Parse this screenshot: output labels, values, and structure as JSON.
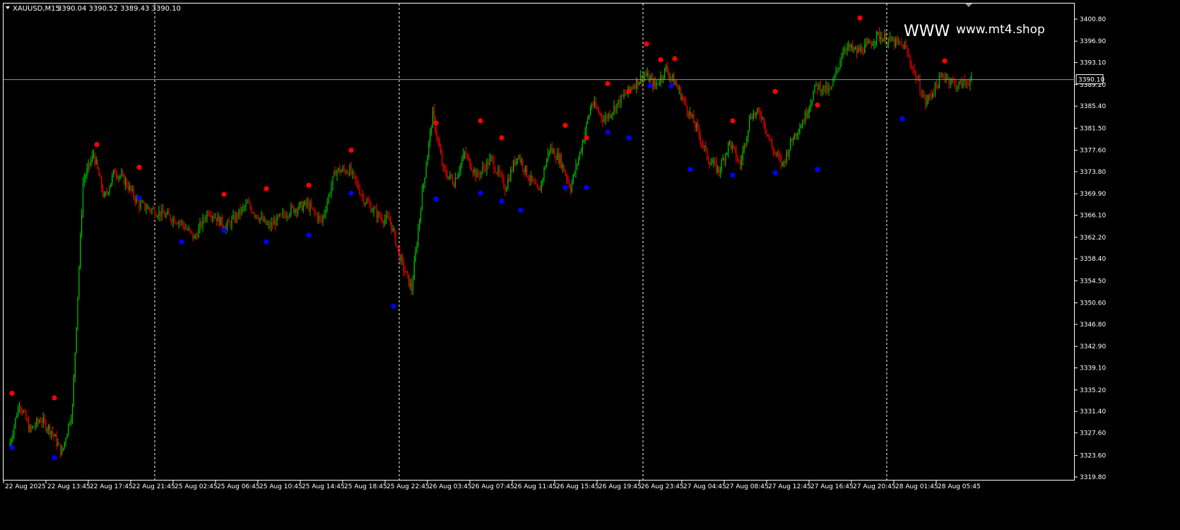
{
  "header": {
    "symbol_label": "XAUUSD,M15",
    "ohlc_label": "3390.04 3390.52 3389.43 3390.10"
  },
  "watermark": {
    "left_text": "WWW",
    "right_text": "www.mt4.shop"
  },
  "colors": {
    "background": "#000000",
    "frame": "#ffffff",
    "bull": "#00c800",
    "bear": "#ff0000",
    "grid": "#ffffff",
    "price_line": "#8a96a6",
    "dot_high": "#ff0000",
    "dot_low": "#0000ff",
    "axis_text": "#ffffff"
  },
  "chart_data": {
    "type": "candlestick",
    "symbol": "XAUUSD",
    "timeframe": "M15",
    "ylim": [
      3319.8,
      3400.8
    ],
    "y_ticks": [
      "3400.80",
      "3396.90",
      "3393.10",
      "3389.20",
      "3385.40",
      "3381.50",
      "3377.60",
      "3373.80",
      "3369.90",
      "3366.10",
      "3362.20",
      "3358.40",
      "3354.50",
      "3350.60",
      "3346.80",
      "3342.90",
      "3339.10",
      "3335.20",
      "3331.40",
      "3327.60",
      "3323.60",
      "3319.80"
    ],
    "x_labels": [
      "22 Aug 2025",
      "22 Aug 13:45",
      "22 Aug 17:45",
      "22 Aug 21:45",
      "25 Aug 02:45",
      "25 Aug 06:45",
      "25 Aug 10:45",
      "25 Aug 14:45",
      "25 Aug 18:45",
      "25 Aug 22:45",
      "26 Aug 03:45",
      "26 Aug 07:45",
      "26 Aug 11:45",
      "26 Aug 15:45",
      "26 Aug 19:45",
      "26 Aug 23:45",
      "27 Aug 04:45",
      "27 Aug 08:45",
      "27 Aug 12:45",
      "27 Aug 16:45",
      "27 Aug 20:45",
      "28 Aug 01:45",
      "28 Aug 05:45"
    ],
    "session_separators": [
      "22 Aug 21:45",
      "25 Aug 22:45",
      "26 Aug 23:45",
      "27 Aug 20:45"
    ],
    "current_price": 3390.1,
    "current_price_label": "3390.10",
    "price_path": [
      {
        "x": "22 Aug 2025",
        "y": 3325
      },
      {
        "x": "22 Aug 2025",
        "y": 3333
      },
      {
        "x": "22 Aug 2025",
        "y": 3328
      },
      {
        "x": "22 Aug 2025",
        "y": 3330
      },
      {
        "x": "22 Aug 13:45",
        "y": 3328
      },
      {
        "x": "22 Aug 13:45",
        "y": 3324
      },
      {
        "x": "22 Aug 13:45",
        "y": 3332
      },
      {
        "x": "22 Aug 13:45",
        "y": 3372
      },
      {
        "x": "22 Aug 17:45",
        "y": 3377
      },
      {
        "x": "22 Aug 17:45",
        "y": 3369
      },
      {
        "x": "22 Aug 17:45",
        "y": 3374
      },
      {
        "x": "22 Aug 17:45",
        "y": 3372
      },
      {
        "x": "22 Aug 21:45",
        "y": 3368
      },
      {
        "x": "25 Aug 02:45",
        "y": 3365
      },
      {
        "x": "25 Aug 02:45",
        "y": 3362
      },
      {
        "x": "25 Aug 02:45",
        "y": 3367
      },
      {
        "x": "25 Aug 06:45",
        "y": 3364
      },
      {
        "x": "25 Aug 06:45",
        "y": 3368
      },
      {
        "x": "25 Aug 10:45",
        "y": 3364
      },
      {
        "x": "25 Aug 10:45",
        "y": 3367
      },
      {
        "x": "25 Aug 14:45",
        "y": 3368
      },
      {
        "x": "25 Aug 14:45",
        "y": 3365
      },
      {
        "x": "25 Aug 14:45",
        "y": 3374
      },
      {
        "x": "25 Aug 18:45",
        "y": 3374
      },
      {
        "x": "25 Aug 18:45",
        "y": 3369
      },
      {
        "x": "25 Aug 18:45",
        "y": 3366
      },
      {
        "x": "25 Aug 22:45",
        "y": 3365
      },
      {
        "x": "25 Aug 22:45",
        "y": 3358
      },
      {
        "x": "25 Aug 22:45",
        "y": 3353
      },
      {
        "x": "25 Aug 22:45",
        "y": 3370
      },
      {
        "x": "26 Aug 03:45",
        "y": 3384
      },
      {
        "x": "26 Aug 03:45",
        "y": 3374
      },
      {
        "x": "26 Aug 03:45",
        "y": 3372
      },
      {
        "x": "26 Aug 03:45",
        "y": 3377
      },
      {
        "x": "26 Aug 07:45",
        "y": 3373
      },
      {
        "x": "26 Aug 07:45",
        "y": 3376
      },
      {
        "x": "26 Aug 07:45",
        "y": 3371
      },
      {
        "x": "26 Aug 11:45",
        "y": 3377
      },
      {
        "x": "26 Aug 11:45",
        "y": 3373
      },
      {
        "x": "26 Aug 11:45",
        "y": 3370
      },
      {
        "x": "26 Aug 11:45",
        "y": 3378
      },
      {
        "x": "26 Aug 15:45",
        "y": 3376
      },
      {
        "x": "26 Aug 15:45",
        "y": 3371
      },
      {
        "x": "26 Aug 15:45",
        "y": 3378
      },
      {
        "x": "26 Aug 15:45",
        "y": 3386
      },
      {
        "x": "26 Aug 19:45",
        "y": 3383
      },
      {
        "x": "26 Aug 19:45",
        "y": 3386
      },
      {
        "x": "26 Aug 19:45",
        "y": 3389
      },
      {
        "x": "26 Aug 23:45",
        "y": 3391
      },
      {
        "x": "26 Aug 23:45",
        "y": 3389
      },
      {
        "x": "26 Aug 23:45",
        "y": 3392
      },
      {
        "x": "26 Aug 23:45",
        "y": 3389
      },
      {
        "x": "27 Aug 04:45",
        "y": 3385
      },
      {
        "x": "27 Aug 04:45",
        "y": 3381
      },
      {
        "x": "27 Aug 04:45",
        "y": 3376
      },
      {
        "x": "27 Aug 04:45",
        "y": 3374
      },
      {
        "x": "27 Aug 08:45",
        "y": 3379
      },
      {
        "x": "27 Aug 08:45",
        "y": 3375
      },
      {
        "x": "27 Aug 08:45",
        "y": 3384
      },
      {
        "x": "27 Aug 08:45",
        "y": 3384
      },
      {
        "x": "27 Aug 12:45",
        "y": 3378
      },
      {
        "x": "27 Aug 12:45",
        "y": 3375
      },
      {
        "x": "27 Aug 12:45",
        "y": 3380
      },
      {
        "x": "27 Aug 12:45",
        "y": 3383
      },
      {
        "x": "27 Aug 16:45",
        "y": 3389
      },
      {
        "x": "27 Aug 16:45",
        "y": 3388
      },
      {
        "x": "27 Aug 16:45",
        "y": 3396
      },
      {
        "x": "27 Aug 20:45",
        "y": 3395
      },
      {
        "x": "27 Aug 20:45",
        "y": 3396
      },
      {
        "x": "27 Aug 20:45",
        "y": 3398
      },
      {
        "x": "27 Aug 20:45",
        "y": 3397
      },
      {
        "x": "28 Aug 01:45",
        "y": 3396
      },
      {
        "x": "28 Aug 01:45",
        "y": 3386
      },
      {
        "x": "28 Aug 05:45",
        "y": 3391
      },
      {
        "x": "28 Aug 05:45",
        "y": 3389
      },
      {
        "x": "28 Aug 05:45",
        "y": 3390.1
      }
    ],
    "fractal_highs": [
      {
        "x": "22 Aug 2025",
        "y": 3334.6
      },
      {
        "x": "22 Aug 13:45",
        "y": 3333.8
      },
      {
        "x": "22 Aug 17:45",
        "y": 3378.6
      },
      {
        "x": "22 Aug 21:45",
        "y": 3374.6
      },
      {
        "x": "25 Aug 06:45",
        "y": 3369.8
      },
      {
        "x": "25 Aug 10:45",
        "y": 3370.8
      },
      {
        "x": "25 Aug 14:45",
        "y": 3371.4
      },
      {
        "x": "25 Aug 18:45",
        "y": 3377.6
      },
      {
        "x": "26 Aug 03:45",
        "y": 3382.4
      },
      {
        "x": "26 Aug 07:45",
        "y": 3382.8
      },
      {
        "x": "26 Aug 07:45",
        "y": 3379.8
      },
      {
        "x": "26 Aug 15:45",
        "y": 3382.0
      },
      {
        "x": "26 Aug 15:45",
        "y": 3379.8
      },
      {
        "x": "26 Aug 19:45",
        "y": 3389.4
      },
      {
        "x": "26 Aug 19:45",
        "y": 3388.0
      },
      {
        "x": "26 Aug 23:45",
        "y": 3396.4
      },
      {
        "x": "26 Aug 23:45",
        "y": 3393.6
      },
      {
        "x": "26 Aug 23:45",
        "y": 3393.8
      },
      {
        "x": "27 Aug 08:45",
        "y": 3382.8
      },
      {
        "x": "27 Aug 12:45",
        "y": 3388.0
      },
      {
        "x": "27 Aug 16:45",
        "y": 3385.6
      },
      {
        "x": "27 Aug 20:45",
        "y": 3401.0
      },
      {
        "x": "28 Aug 05:45",
        "y": 3393.4
      }
    ],
    "fractal_lows": [
      {
        "x": "22 Aug 2025",
        "y": 3325.0
      },
      {
        "x": "22 Aug 13:45",
        "y": 3323.2
      },
      {
        "x": "22 Aug 21:45",
        "y": 3369.2
      },
      {
        "x": "25 Aug 02:45",
        "y": 3361.4
      },
      {
        "x": "25 Aug 06:45",
        "y": 3363.4
      },
      {
        "x": "25 Aug 10:45",
        "y": 3361.4
      },
      {
        "x": "25 Aug 14:45",
        "y": 3362.6
      },
      {
        "x": "25 Aug 18:45",
        "y": 3370.0
      },
      {
        "x": "25 Aug 22:45",
        "y": 3350.0
      },
      {
        "x": "26 Aug 03:45",
        "y": 3369.0
      },
      {
        "x": "26 Aug 07:45",
        "y": 3370.0
      },
      {
        "x": "26 Aug 07:45",
        "y": 3368.6
      },
      {
        "x": "26 Aug 11:45",
        "y": 3367.0
      },
      {
        "x": "26 Aug 15:45",
        "y": 3371.0
      },
      {
        "x": "26 Aug 15:45",
        "y": 3371.0
      },
      {
        "x": "26 Aug 19:45",
        "y": 3380.8
      },
      {
        "x": "26 Aug 19:45",
        "y": 3379.8
      },
      {
        "x": "26 Aug 23:45",
        "y": 3389.0
      },
      {
        "x": "26 Aug 23:45",
        "y": 3389.0
      },
      {
        "x": "27 Aug 04:45",
        "y": 3374.2
      },
      {
        "x": "27 Aug 08:45",
        "y": 3373.2
      },
      {
        "x": "27 Aug 12:45",
        "y": 3373.6
      },
      {
        "x": "27 Aug 16:45",
        "y": 3374.2
      },
      {
        "x": "28 Aug 01:45",
        "y": 3383.2
      }
    ]
  }
}
